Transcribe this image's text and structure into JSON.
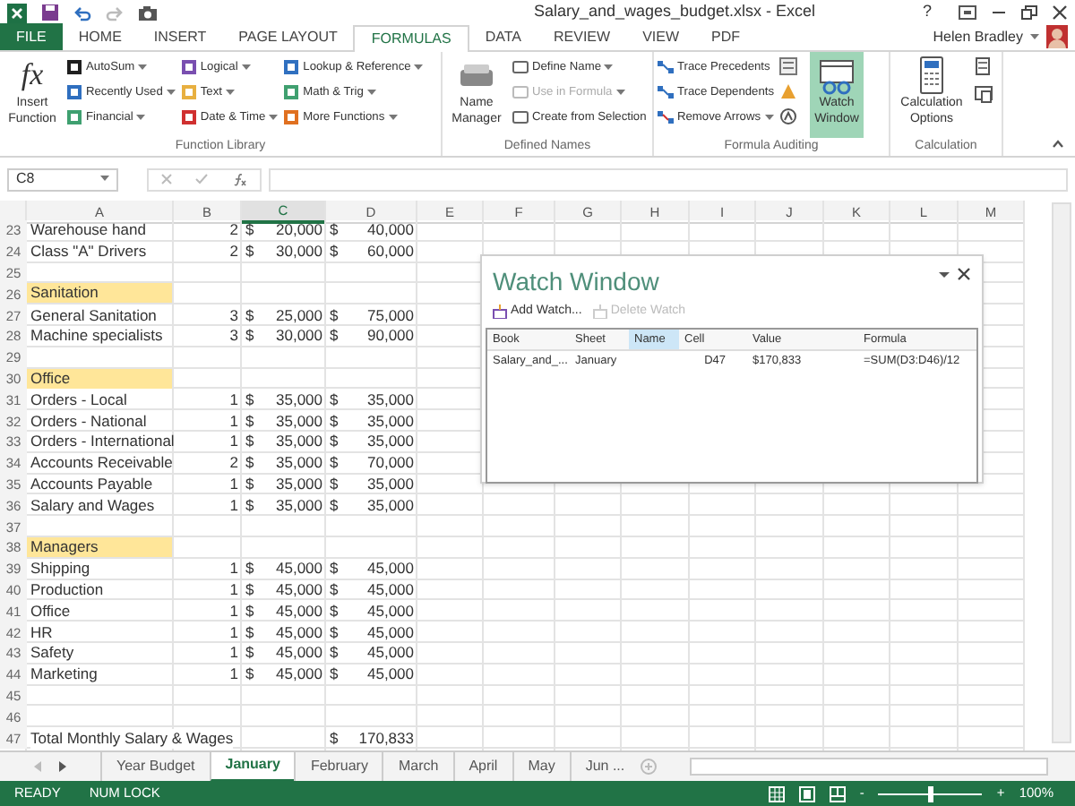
{
  "window": {
    "title": "Salary_and_wages_budget.xlsx - Excel",
    "help": "?",
    "user": "Helen Bradley"
  },
  "tabs": [
    {
      "label": "FILE",
      "selected": false,
      "kind": "file"
    },
    {
      "label": "HOME",
      "selected": false,
      "kind": "tab"
    },
    {
      "label": "INSERT",
      "selected": false,
      "kind": "tab"
    },
    {
      "label": "PAGE LAYOUT",
      "selected": false,
      "kind": "tab"
    },
    {
      "label": "FORMULAS",
      "selected": true,
      "kind": "tab"
    },
    {
      "label": "DATA",
      "selected": false,
      "kind": "tab"
    },
    {
      "label": "REVIEW",
      "selected": false,
      "kind": "tab"
    },
    {
      "label": "VIEW",
      "selected": false,
      "kind": "tab"
    },
    {
      "label": "PDF",
      "selected": false,
      "kind": "tab"
    }
  ],
  "ribbon": [
    {
      "kind": "library",
      "label": "Function Library",
      "large": [
        {
          "label": "Insert Function",
          "selected": false,
          "icon_text": "fx"
        }
      ],
      "items": [
        {
          "label": "AutoSum",
          "color": "#1f1f1f"
        },
        {
          "label": "Recently Used",
          "color": "#2f6fbf"
        },
        {
          "label": "Financial",
          "color": "#3fa070"
        },
        {
          "label": "Logical",
          "color": "#7a4fb0"
        },
        {
          "label": "Text",
          "color": "#e8b040"
        },
        {
          "label": "Date & Time",
          "color": "#d03030"
        },
        {
          "label": "Lookup & Reference",
          "color": "#3070c0"
        },
        {
          "label": "Math & Trig",
          "color": "#40a070"
        },
        {
          "label": "More Functions",
          "color": "#e07020"
        }
      ]
    },
    {
      "kind": "names",
      "label": "Defined Names",
      "large": [
        {
          "label": "Name Manager",
          "selected": false
        }
      ],
      "items": [
        {
          "label": "Define Name",
          "disabled": false
        },
        {
          "label": "Use in Formula",
          "disabled": true
        },
        {
          "label": "Create from Selection",
          "disabled": false
        }
      ]
    },
    {
      "kind": "auditing",
      "label": "Formula Auditing",
      "large": [
        {
          "label": "Watch Window",
          "selected": true
        }
      ],
      "items": [
        {
          "label": "Trace Precedents",
          "disabled": false
        },
        {
          "label": "Trace Dependents",
          "disabled": false
        },
        {
          "label": "Remove Arrows",
          "disabled": false
        }
      ]
    },
    {
      "kind": "calculation",
      "label": "Calculation",
      "large": [
        {
          "label": "Calculation Options",
          "selected": false
        }
      ]
    }
  ],
  "name_box": "C8",
  "columns": [
    {
      "label": "A",
      "selected": false
    },
    {
      "label": "B",
      "selected": false
    },
    {
      "label": "C",
      "selected": true
    },
    {
      "label": "D",
      "selected": false
    },
    {
      "label": "E",
      "selected": false
    },
    {
      "label": "F",
      "selected": false
    },
    {
      "label": "G",
      "selected": false
    },
    {
      "label": "H",
      "selected": false
    },
    {
      "label": "I",
      "selected": false
    },
    {
      "label": "J",
      "selected": false
    },
    {
      "label": "K",
      "selected": false
    },
    {
      "label": "L",
      "selected": false
    },
    {
      "label": "M",
      "selected": false
    }
  ],
  "rows": [
    {
      "row": "23",
      "kind": "item",
      "label": "Warehouse hand",
      "count": "2",
      "rate_symbol": "$",
      "rate": "20,000",
      "total_symbol": "$",
      "total": "40,000"
    },
    {
      "row": "24",
      "kind": "item",
      "label": "Class \"A\" Drivers",
      "count": "2",
      "rate_symbol": "$",
      "rate": "30,000",
      "total_symbol": "$",
      "total": "60,000"
    },
    {
      "row": "25",
      "kind": "blank"
    },
    {
      "row": "26",
      "kind": "section",
      "label": "Sanitation"
    },
    {
      "row": "27",
      "kind": "item",
      "label": "General Sanitation",
      "count": "3",
      "rate_symbol": "$",
      "rate": "25,000",
      "total_symbol": "$",
      "total": "75,000"
    },
    {
      "row": "28",
      "kind": "item",
      "label": "Machine specialists",
      "count": "3",
      "rate_symbol": "$",
      "rate": "30,000",
      "total_symbol": "$",
      "total": "90,000"
    },
    {
      "row": "29",
      "kind": "blank"
    },
    {
      "row": "30",
      "kind": "section",
      "label": "Office"
    },
    {
      "row": "31",
      "kind": "item",
      "label": "Orders - Local",
      "count": "1",
      "rate_symbol": "$",
      "rate": "35,000",
      "total_symbol": "$",
      "total": "35,000"
    },
    {
      "row": "32",
      "kind": "item",
      "label": "Orders - National",
      "count": "1",
      "rate_symbol": "$",
      "rate": "35,000",
      "total_symbol": "$",
      "total": "35,000"
    },
    {
      "row": "33",
      "kind": "item",
      "label": "Orders - International",
      "count": "1",
      "rate_symbol": "$",
      "rate": "35,000",
      "total_symbol": "$",
      "total": "35,000"
    },
    {
      "row": "34",
      "kind": "item",
      "label": "Accounts Receivable",
      "count": "2",
      "rate_symbol": "$",
      "rate": "35,000",
      "total_symbol": "$",
      "total": "70,000"
    },
    {
      "row": "35",
      "kind": "item",
      "label": "Accounts Payable",
      "count": "1",
      "rate_symbol": "$",
      "rate": "35,000",
      "total_symbol": "$",
      "total": "35,000"
    },
    {
      "row": "36",
      "kind": "item",
      "label": "Salary and Wages",
      "count": "1",
      "rate_symbol": "$",
      "rate": "35,000",
      "total_symbol": "$",
      "total": "35,000"
    },
    {
      "row": "37",
      "kind": "blank"
    },
    {
      "row": "38",
      "kind": "section",
      "label": "Managers"
    },
    {
      "row": "39",
      "kind": "item",
      "label": "Shipping",
      "count": "1",
      "rate_symbol": "$",
      "rate": "45,000",
      "total_symbol": "$",
      "total": "45,000"
    },
    {
      "row": "40",
      "kind": "item",
      "label": "Production",
      "count": "1",
      "rate_symbol": "$",
      "rate": "45,000",
      "total_symbol": "$",
      "total": "45,000"
    },
    {
      "row": "41",
      "kind": "item",
      "label": "Office",
      "count": "1",
      "rate_symbol": "$",
      "rate": "45,000",
      "total_symbol": "$",
      "total": "45,000"
    },
    {
      "row": "42",
      "kind": "item",
      "label": "HR",
      "count": "1",
      "rate_symbol": "$",
      "rate": "45,000",
      "total_symbol": "$",
      "total": "45,000"
    },
    {
      "row": "43",
      "kind": "item",
      "label": "Safety",
      "count": "1",
      "rate_symbol": "$",
      "rate": "45,000",
      "total_symbol": "$",
      "total": "45,000"
    },
    {
      "row": "44",
      "kind": "item",
      "label": "Marketing",
      "count": "1",
      "rate_symbol": "$",
      "rate": "45,000",
      "total_symbol": "$",
      "total": "45,000"
    },
    {
      "row": "45",
      "kind": "blank"
    },
    {
      "row": "46",
      "kind": "blank"
    },
    {
      "row": "47",
      "kind": "total",
      "label": "Total Monthly Salary & Wages",
      "total_symbol": "$",
      "total": "170,833"
    }
  ],
  "watch_window": {
    "title": "Watch Window",
    "toolbar": [
      {
        "label": "Add Watch...",
        "disabled": false
      },
      {
        "label": "Delete Watch",
        "disabled": true
      }
    ],
    "columns": [
      {
        "label": "Book",
        "selected": false
      },
      {
        "label": "Sheet",
        "selected": false
      },
      {
        "label": "Name",
        "selected": true
      },
      {
        "label": "Cell",
        "selected": false
      },
      {
        "label": "Value",
        "selected": false
      },
      {
        "label": "Formula",
        "selected": false
      }
    ],
    "rows": [
      {
        "book": "Salary_and_...",
        "sheet": "January",
        "cell": "D47",
        "value": "$170,833",
        "formula": "=SUM(D3:D46)/12"
      }
    ]
  },
  "sheet_tabs": [
    {
      "label": "Year Budget",
      "selected": false
    },
    {
      "label": "January",
      "selected": true
    },
    {
      "label": "February",
      "selected": false
    },
    {
      "label": "March",
      "selected": false
    },
    {
      "label": "April",
      "selected": false
    },
    {
      "label": "May",
      "selected": false
    },
    {
      "label": "Jun ...",
      "selected": false
    }
  ],
  "status_bar": {
    "items": [
      "READY",
      "NUM LOCK"
    ],
    "zoom": {
      "level": 0.5
    },
    "zoom_out": "-",
    "zoom_in": "+",
    "zoom_text": "100%"
  }
}
